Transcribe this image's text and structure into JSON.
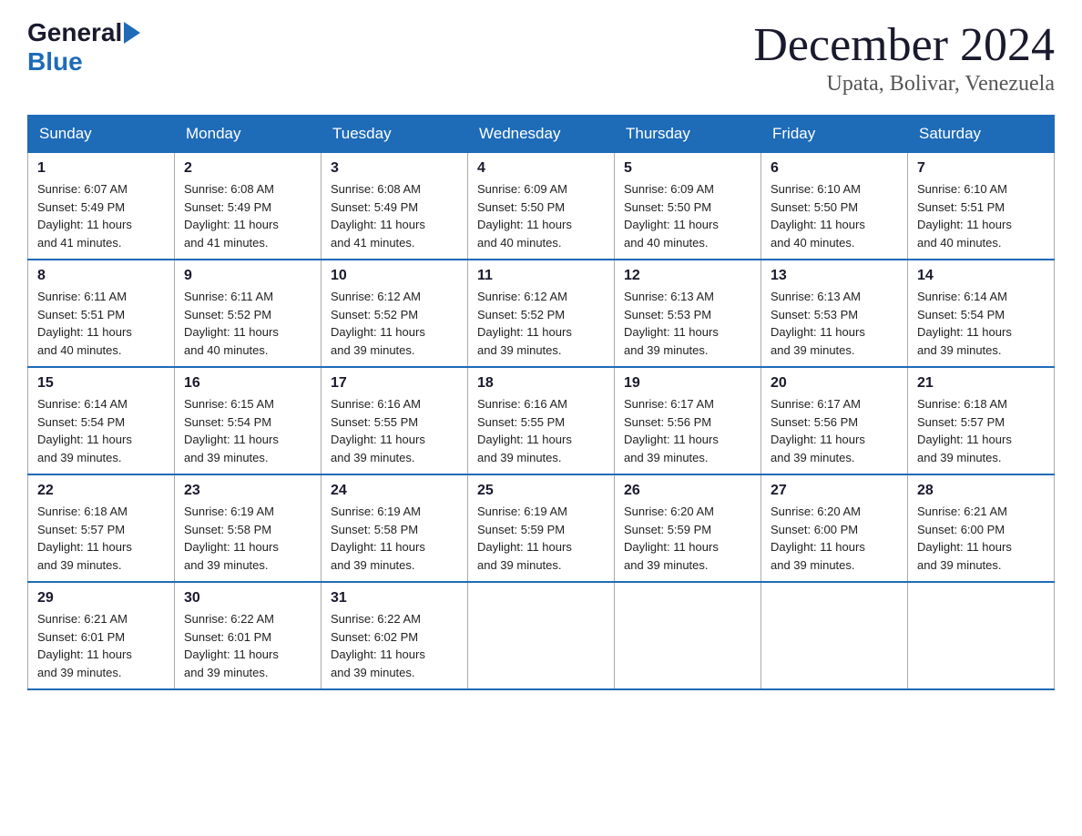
{
  "logo": {
    "text1": "General",
    "text2": "Blue"
  },
  "title": "December 2024",
  "location": "Upata, Bolivar, Venezuela",
  "days_header": [
    "Sunday",
    "Monday",
    "Tuesday",
    "Wednesday",
    "Thursday",
    "Friday",
    "Saturday"
  ],
  "weeks": [
    [
      {
        "num": "1",
        "info": "Sunrise: 6:07 AM\nSunset: 5:49 PM\nDaylight: 11 hours\nand 41 minutes."
      },
      {
        "num": "2",
        "info": "Sunrise: 6:08 AM\nSunset: 5:49 PM\nDaylight: 11 hours\nand 41 minutes."
      },
      {
        "num": "3",
        "info": "Sunrise: 6:08 AM\nSunset: 5:49 PM\nDaylight: 11 hours\nand 41 minutes."
      },
      {
        "num": "4",
        "info": "Sunrise: 6:09 AM\nSunset: 5:50 PM\nDaylight: 11 hours\nand 40 minutes."
      },
      {
        "num": "5",
        "info": "Sunrise: 6:09 AM\nSunset: 5:50 PM\nDaylight: 11 hours\nand 40 minutes."
      },
      {
        "num": "6",
        "info": "Sunrise: 6:10 AM\nSunset: 5:50 PM\nDaylight: 11 hours\nand 40 minutes."
      },
      {
        "num": "7",
        "info": "Sunrise: 6:10 AM\nSunset: 5:51 PM\nDaylight: 11 hours\nand 40 minutes."
      }
    ],
    [
      {
        "num": "8",
        "info": "Sunrise: 6:11 AM\nSunset: 5:51 PM\nDaylight: 11 hours\nand 40 minutes."
      },
      {
        "num": "9",
        "info": "Sunrise: 6:11 AM\nSunset: 5:52 PM\nDaylight: 11 hours\nand 40 minutes."
      },
      {
        "num": "10",
        "info": "Sunrise: 6:12 AM\nSunset: 5:52 PM\nDaylight: 11 hours\nand 39 minutes."
      },
      {
        "num": "11",
        "info": "Sunrise: 6:12 AM\nSunset: 5:52 PM\nDaylight: 11 hours\nand 39 minutes."
      },
      {
        "num": "12",
        "info": "Sunrise: 6:13 AM\nSunset: 5:53 PM\nDaylight: 11 hours\nand 39 minutes."
      },
      {
        "num": "13",
        "info": "Sunrise: 6:13 AM\nSunset: 5:53 PM\nDaylight: 11 hours\nand 39 minutes."
      },
      {
        "num": "14",
        "info": "Sunrise: 6:14 AM\nSunset: 5:54 PM\nDaylight: 11 hours\nand 39 minutes."
      }
    ],
    [
      {
        "num": "15",
        "info": "Sunrise: 6:14 AM\nSunset: 5:54 PM\nDaylight: 11 hours\nand 39 minutes."
      },
      {
        "num": "16",
        "info": "Sunrise: 6:15 AM\nSunset: 5:54 PM\nDaylight: 11 hours\nand 39 minutes."
      },
      {
        "num": "17",
        "info": "Sunrise: 6:16 AM\nSunset: 5:55 PM\nDaylight: 11 hours\nand 39 minutes."
      },
      {
        "num": "18",
        "info": "Sunrise: 6:16 AM\nSunset: 5:55 PM\nDaylight: 11 hours\nand 39 minutes."
      },
      {
        "num": "19",
        "info": "Sunrise: 6:17 AM\nSunset: 5:56 PM\nDaylight: 11 hours\nand 39 minutes."
      },
      {
        "num": "20",
        "info": "Sunrise: 6:17 AM\nSunset: 5:56 PM\nDaylight: 11 hours\nand 39 minutes."
      },
      {
        "num": "21",
        "info": "Sunrise: 6:18 AM\nSunset: 5:57 PM\nDaylight: 11 hours\nand 39 minutes."
      }
    ],
    [
      {
        "num": "22",
        "info": "Sunrise: 6:18 AM\nSunset: 5:57 PM\nDaylight: 11 hours\nand 39 minutes."
      },
      {
        "num": "23",
        "info": "Sunrise: 6:19 AM\nSunset: 5:58 PM\nDaylight: 11 hours\nand 39 minutes."
      },
      {
        "num": "24",
        "info": "Sunrise: 6:19 AM\nSunset: 5:58 PM\nDaylight: 11 hours\nand 39 minutes."
      },
      {
        "num": "25",
        "info": "Sunrise: 6:19 AM\nSunset: 5:59 PM\nDaylight: 11 hours\nand 39 minutes."
      },
      {
        "num": "26",
        "info": "Sunrise: 6:20 AM\nSunset: 5:59 PM\nDaylight: 11 hours\nand 39 minutes."
      },
      {
        "num": "27",
        "info": "Sunrise: 6:20 AM\nSunset: 6:00 PM\nDaylight: 11 hours\nand 39 minutes."
      },
      {
        "num": "28",
        "info": "Sunrise: 6:21 AM\nSunset: 6:00 PM\nDaylight: 11 hours\nand 39 minutes."
      }
    ],
    [
      {
        "num": "29",
        "info": "Sunrise: 6:21 AM\nSunset: 6:01 PM\nDaylight: 11 hours\nand 39 minutes."
      },
      {
        "num": "30",
        "info": "Sunrise: 6:22 AM\nSunset: 6:01 PM\nDaylight: 11 hours\nand 39 minutes."
      },
      {
        "num": "31",
        "info": "Sunrise: 6:22 AM\nSunset: 6:02 PM\nDaylight: 11 hours\nand 39 minutes."
      },
      null,
      null,
      null,
      null
    ]
  ]
}
